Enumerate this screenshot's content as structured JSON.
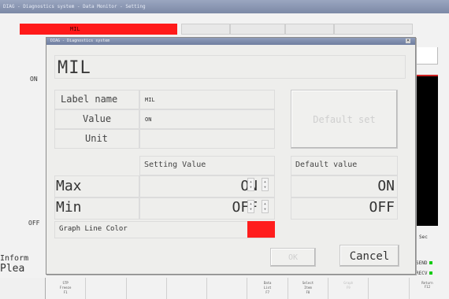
{
  "app": {
    "title": "DIAG - Diagnostics system - Data Monitor - Setting",
    "tab_label": "MIL",
    "side_on": "ON",
    "side_off": "OFF",
    "info_line1": "Inform",
    "info_line2": "Plea",
    "sec_label": "Sec",
    "send_label": "SEND",
    "recv_label": "RECV",
    "function_keys": [
      {
        "line1": "STP",
        "line2": "Freeze",
        "line3": "F1"
      },
      {
        "line1": "",
        "line2": "",
        "line3": ""
      },
      {
        "line1": "",
        "line2": "",
        "line3": ""
      },
      {
        "line1": "",
        "line2": "",
        "line3": ""
      },
      {
        "line1": "",
        "line2": "",
        "line3": ""
      },
      {
        "line1": "Data",
        "line2": "List",
        "line3": "F7"
      },
      {
        "line1": "Select",
        "line2": "Item",
        "line3": "F8"
      },
      {
        "line1": "Graph",
        "line2": "",
        "line3": "F9"
      },
      {
        "line1": "",
        "line2": "",
        "line3": ""
      },
      {
        "line1": "",
        "line2": "",
        "line3": ""
      }
    ],
    "function_key_right": {
      "line1": "Return",
      "line2": "",
      "line3": "F12"
    }
  },
  "dialog": {
    "title": "DIAG - Diagnostics system",
    "close_glyph": "×",
    "item_title": "MIL",
    "label_name_label": "Label name",
    "label_name_value": "MIL",
    "value_label": "Value",
    "value_value": "ON",
    "unit_label": "Unit",
    "unit_value": "",
    "default_set_button": "Default set",
    "setting_value_header": "Setting Value",
    "default_value_header": "Default value",
    "max_label": "Max",
    "max_setting": "ON",
    "max_default": "ON",
    "min_label": "Min",
    "min_setting": "OFF",
    "min_default": "OFF",
    "graph_line_color_label": "Graph Line Color",
    "graph_line_color": "#ff1d1d",
    "ok_button": "OK",
    "cancel_button": "Cancel"
  }
}
